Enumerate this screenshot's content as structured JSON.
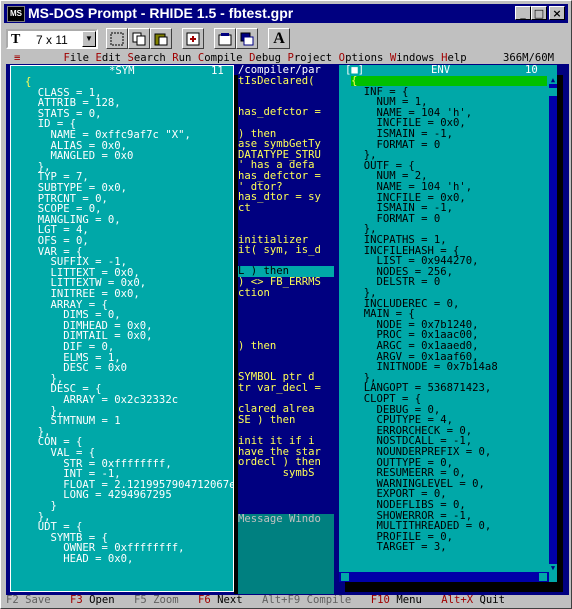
{
  "window": {
    "title": "MS-DOS Prompt - RHIDE 1.5 - fbtest.gpr",
    "icon": "msdos-icon",
    "min_label": "_",
    "max_label": "□",
    "close_label": "×"
  },
  "toolbar": {
    "font_icon": "T",
    "font_size": "7 x 11",
    "dropdown_arrow": "▼",
    "buttons": [
      "mark-icon",
      "copy-icon",
      "paste-icon",
      "fullscreen-icon",
      "properties-icon",
      "background-icon",
      "font-icon"
    ],
    "font_button_label": "A"
  },
  "menubar": {
    "system": "≡",
    "items": [
      {
        "label": "File",
        "hot": "F",
        "rest": "ile"
      },
      {
        "label": "Edit",
        "hot": "E",
        "rest": "dit"
      },
      {
        "label": "Search",
        "hot": "S",
        "rest": "earch"
      },
      {
        "label": "Run",
        "hot": "R",
        "rest": "un"
      },
      {
        "label": "Compile",
        "hot": "C",
        "rest": "ompile"
      },
      {
        "label": "Debug",
        "hot": "D",
        "rest": "ebug"
      },
      {
        "label": "Project",
        "hot": "P",
        "rest": "roject"
      },
      {
        "label": "Options",
        "hot": "O",
        "rest": "ptions"
      },
      {
        "label": "Windows",
        "hot": "W",
        "rest": "indows"
      },
      {
        "label": "Help",
        "hot": "H",
        "rest": "elp"
      }
    ],
    "memory": "366M/60M"
  },
  "sym_window": {
    "title": "*SYM",
    "number": "11",
    "lines": [
      "{",
      "  CLASS = 1,",
      "  ATTRIB = 128,",
      "  STATS = 0,",
      "  ID = {",
      "    NAME = 0xffc9af7c \"X\",",
      "    ALIAS = 0x0,",
      "    MANGLED = 0x0",
      "  },",
      "  TYP = 7,",
      "  SUBTYPE = 0x0,",
      "  PTRCNT = 0,",
      "  SCOPE = 0,",
      "  MANGLING = 0,",
      "  LGT = 4,",
      "  OFS = 0,",
      "  VAR = {",
      "    SUFFIX = -1,",
      "    LITTEXT = 0x0,",
      "    LITTEXTW = 0x0,",
      "    INITREE = 0x0,",
      "    ARRAY = {",
      "      DIMS = 0,",
      "      DIMHEAD = 0x0,",
      "      DIMTAIL = 0x0,",
      "      DIF = 0,",
      "      ELMS = 1,",
      "      DESC = 0x0",
      "    },",
      "    DESC = {",
      "      ARRAY = 0x2c32332c",
      "    },",
      "    STMTNUM = 1",
      "  },",
      "  CON = {",
      "    VAL = {",
      "      STR = 0xffffffff,",
      "      INT = -1,",
      "      FLOAT = 2.1219957904712067e",
      "      LONG = 4294967295",
      "    }",
      "  },",
      "  UDT = {",
      "    SYMTB = {",
      "      OWNER = 0xffffffff,",
      "      HEAD = 0x0,"
    ]
  },
  "editor_window": {
    "title": "/compiler/par",
    "lines": [
      "tIsDeclared(",
      "",
      "",
      "has_defctor =",
      "",
      ") then",
      "ase symbGetTy",
      "DATATYPE_STRU",
      "' has a defa",
      "has_defctor =",
      "' dtor?",
      "has_dtor = sy",
      "ct",
      "",
      "",
      "initializer",
      "it( sym, is_d",
      "",
      "L ) then",
      ") <> FB_ERRMS",
      "ction",
      "",
      "",
      "",
      "",
      ") then",
      "",
      "",
      "SYMBOL ptr d",
      "tr var_decl =",
      "",
      "clared alrea",
      "SE ) then",
      "",
      "init it if i",
      "have the star",
      "ordecl ) then",
      "       symbS"
    ]
  },
  "message_window": {
    "title": "Message Windo"
  },
  "env_window": {
    "close_label": "[■]",
    "title": "ENV",
    "number": "10",
    "lines": [
      "{",
      "  INF = {",
      "    NUM = 1,",
      "    NAME = 104 'h',",
      "    INCFILE = 0x0,",
      "    ISMAIN = -1,",
      "    FORMAT = 0",
      "  },",
      "  OUTF = {",
      "    NUM = 2,",
      "    NAME = 104 'h',",
      "    INCFILE = 0x0,",
      "    ISMAIN = -1,",
      "    FORMAT = 0",
      "  },",
      "  INCPATHS = 1,",
      "  INCFILEHASH = {",
      "    LIST = 0x944270,",
      "    NODES = 256,",
      "    DELSTR = 0",
      "  },",
      "  INCLUDEREC = 0,",
      "  MAIN = {",
      "    NODE = 0x7b1240,",
      "    PROC = 0x1aac00,",
      "    ARGC = 0x1aaed0,",
      "    ARGV = 0x1aaf60,",
      "    INITNODE = 0x7b14a8",
      "  },",
      "  LANGOPT = 536871423,",
      "  CLOPT = {",
      "    DEBUG = 0,",
      "    CPUTYPE = 4,",
      "    ERRORCHECK = 0,",
      "    NOSTDCALL = -1,",
      "    NOUNDERPREFIX = 0,",
      "    OUTTYPE = 0,",
      "    RESUMEERR = 0,",
      "    WARNINGLEVEL = 0,",
      "    EXPORT = 0,",
      "    NODEFLIBS = 0,",
      "    SHOWERROR = -1,",
      "    MULTITHREADED = 0,",
      "    PROFILE = 0,",
      "    TARGET = 3,"
    ]
  },
  "statusbar": {
    "items": [
      {
        "key": "F2",
        "label": " Save",
        "disabled": true
      },
      {
        "key": "F3",
        "label": " Open",
        "disabled": false
      },
      {
        "key": "F5",
        "label": " Zoom",
        "disabled": true
      },
      {
        "key": "F6",
        "label": " Next",
        "disabled": false
      },
      {
        "key": "Alt+F9",
        "label": " Compile",
        "disabled": true
      },
      {
        "key": "F10",
        "label": " Menu",
        "disabled": false
      },
      {
        "key": "Alt+X",
        "label": " Quit",
        "disabled": false
      }
    ]
  },
  "colors": {
    "dos_blue": "#000080",
    "dos_cyan": "#00a8a8",
    "dos_gray": "#c0c0c0",
    "dos_yellow": "#ffff55",
    "dos_red": "#a00000",
    "title_bar": "#000080"
  }
}
